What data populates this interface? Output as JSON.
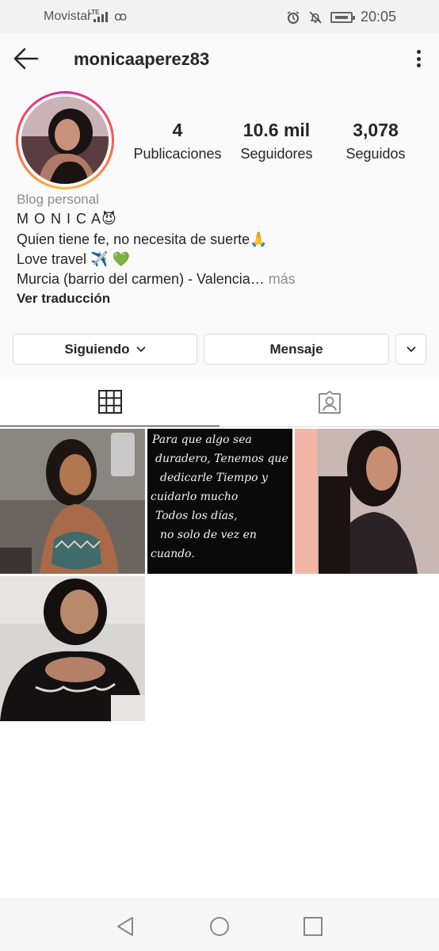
{
  "status_bar": {
    "carrier": "Movistar",
    "network": "LTE",
    "time": "20:05"
  },
  "header": {
    "username": "monicaaperez83",
    "back_icon": "arrow-left-icon",
    "more_icon": "more-vertical-icon"
  },
  "profile": {
    "stats": [
      {
        "value": "4",
        "label": "Publicaciones"
      },
      {
        "value": "10.6 mil",
        "label": "Seguidores"
      },
      {
        "value": "3,078",
        "label": "Seguidos"
      }
    ],
    "category": "Blog personal",
    "bio": {
      "name_line": "M O N I C A",
      "name_emoji": "😈",
      "line2": "Quien tiene fe, no necesita de suerte",
      "line2_emoji": "🙏",
      "line3": "Love travel",
      "line3_emoji": "✈️ 💚",
      "line4": "Murcia (barrio del carmen) - Valencia…",
      "line4_more": " más"
    },
    "translate_label": "Ver traducción"
  },
  "actions": {
    "following_label": "Siguiendo",
    "message_label": "Mensaje"
  },
  "tabs": [
    {
      "icon": "grid-icon",
      "active": true
    },
    {
      "icon": "tagged-icon",
      "active": false
    }
  ],
  "posts": {
    "count": 4,
    "post2_text": [
      "Para que algo sea",
      "duradero, Tenemos que",
      "dedicarle Tiempo y",
      "cuidarlo mucho",
      "Todos los días,",
      "no solo de vez en",
      "cuando."
    ]
  },
  "colors": {
    "accent_ring": "#d6249f",
    "text": "#262626",
    "muted": "#8e8e8e"
  }
}
